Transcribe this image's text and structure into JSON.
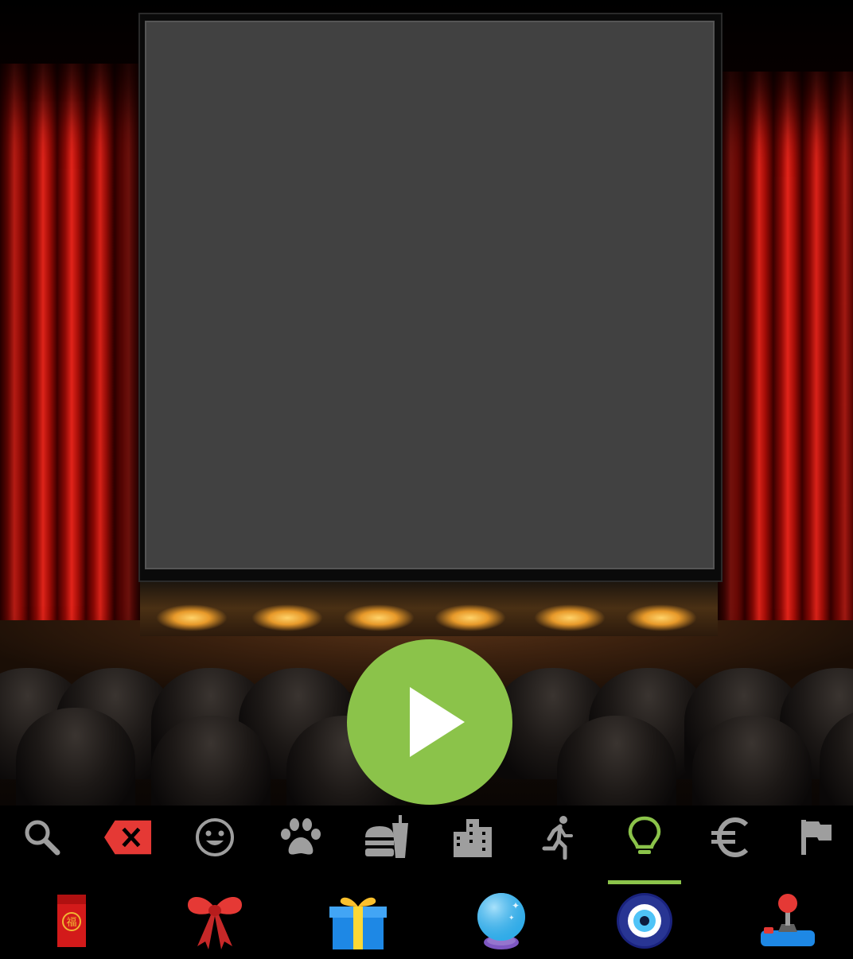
{
  "app": {
    "accent_color": "#8bc34a",
    "screen_color": "#414141",
    "icon_color_inactive": "#9e9e9e",
    "delete_color": "#e53935"
  },
  "player": {
    "play_icon": "play-icon"
  },
  "category_bar": {
    "items": [
      {
        "name": "search-icon",
        "active": false
      },
      {
        "name": "backspace-icon",
        "active": false
      },
      {
        "name": "smiley-icon",
        "active": false
      },
      {
        "name": "paw-icon",
        "active": false
      },
      {
        "name": "food-drink-icon",
        "active": false
      },
      {
        "name": "city-icon",
        "active": false
      },
      {
        "name": "running-person-icon",
        "active": false
      },
      {
        "name": "lightbulb-icon",
        "active": true
      },
      {
        "name": "euro-icon",
        "active": false
      },
      {
        "name": "flag-icon",
        "active": false
      }
    ]
  },
  "emoji_row": {
    "selected_index": 4,
    "items": [
      {
        "name": "red-envelope-emoji",
        "char": "福"
      },
      {
        "name": "ribbon-emoji"
      },
      {
        "name": "gift-emoji"
      },
      {
        "name": "crystal-ball-emoji"
      },
      {
        "name": "nazar-amulet-emoji"
      },
      {
        "name": "joystick-emoji"
      }
    ]
  }
}
